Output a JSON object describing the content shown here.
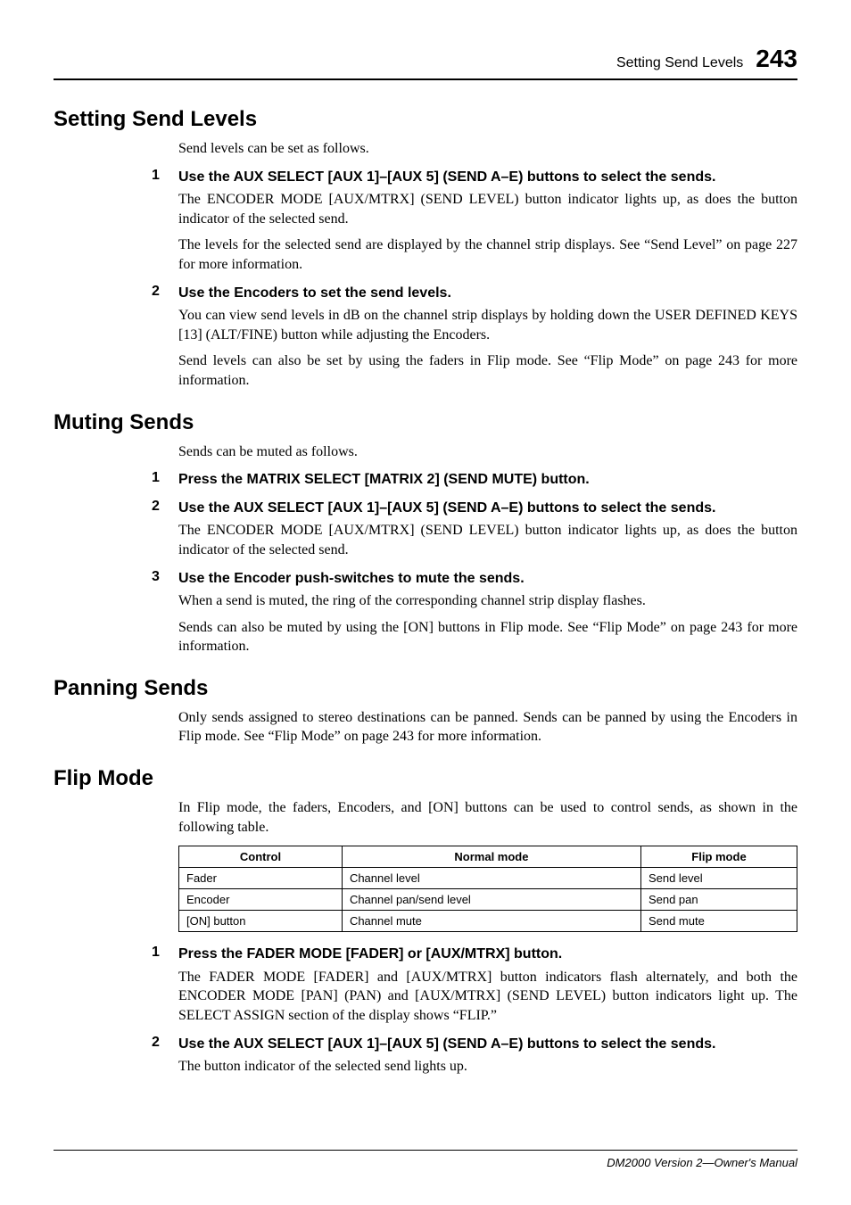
{
  "running_head": {
    "title": "Setting Send Levels",
    "page_number": "243"
  },
  "sections": {
    "setting_send_levels": {
      "heading": "Setting Send Levels",
      "intro": "Send levels can be set as follows.",
      "step1_num": "1",
      "step1_head": "Use the AUX SELECT [AUX 1]–[AUX 5] (SEND A–E) buttons to select the sends.",
      "step1_b1": "The ENCODER MODE [AUX/MTRX] (SEND LEVEL) button indicator lights up, as does the button indicator of the selected send.",
      "step1_b2": "The levels for the selected send are displayed by the channel strip displays. See “Send Level” on page 227 for more information.",
      "step2_num": "2",
      "step2_head": "Use the Encoders to set the send levels.",
      "step2_b1": "You can view send levels in dB on the channel strip displays by holding down the USER DEFINED KEYS [13] (ALT/FINE) button while adjusting the Encoders.",
      "step2_b2": "Send levels can also be set by using the faders in Flip mode. See “Flip Mode” on page 243 for more information."
    },
    "muting_sends": {
      "heading": "Muting Sends",
      "intro": "Sends can be muted as follows.",
      "step1_num": "1",
      "step1_head": "Press the MATRIX SELECT [MATRIX 2] (SEND MUTE) button.",
      "step2_num": "2",
      "step2_head": "Use the AUX SELECT [AUX 1]–[AUX 5] (SEND A–E) buttons to select the sends.",
      "step2_b1": "The ENCODER MODE [AUX/MTRX] (SEND LEVEL) button indicator lights up, as does the button indicator of the selected send.",
      "step3_num": "3",
      "step3_head": "Use the Encoder push-switches to mute the sends.",
      "step3_b1": "When a send is muted, the ring of the corresponding channel strip display flashes.",
      "step3_b2": "Sends can also be muted by using the [ON] buttons in Flip mode. See “Flip Mode” on page 243 for more information."
    },
    "panning_sends": {
      "heading": "Panning Sends",
      "intro": "Only sends assigned to stereo destinations can be panned. Sends can be panned by using the Encoders in Flip mode. See “Flip Mode” on page 243 for more information."
    },
    "flip_mode": {
      "heading": "Flip Mode",
      "intro": "In Flip mode, the faders, Encoders, and [ON] buttons can be used to control sends, as shown in the following table.",
      "table": {
        "headers": {
          "c0": "Control",
          "c1": "Normal mode",
          "c2": "Flip mode"
        },
        "rows": {
          "r0": {
            "c0": "Fader",
            "c1": "Channel level",
            "c2": "Send level"
          },
          "r1": {
            "c0": "Encoder",
            "c1": "Channel pan/send level",
            "c2": "Send pan"
          },
          "r2": {
            "c0": "[ON] button",
            "c1": "Channel mute",
            "c2": "Send mute"
          }
        }
      },
      "step1_num": "1",
      "step1_head": "Press the FADER MODE [FADER] or [AUX/MTRX] button.",
      "step1_b1": "The FADER MODE [FADER] and [AUX/MTRX] button indicators flash alternately, and both the ENCODER MODE [PAN] (PAN) and [AUX/MTRX] (SEND LEVEL) button indicators light up. The SELECT ASSIGN section of the display shows “FLIP.”",
      "step2_num": "2",
      "step2_head": "Use the AUX SELECT [AUX 1]–[AUX 5] (SEND A–E) buttons to select the sends.",
      "step2_b1": "The button indicator of the selected send lights up."
    }
  },
  "footer": "DM2000 Version 2—Owner's Manual"
}
